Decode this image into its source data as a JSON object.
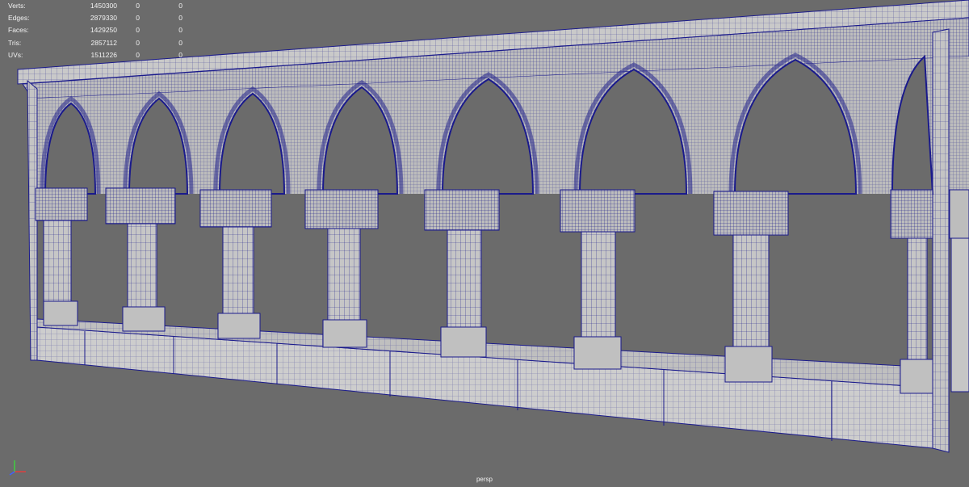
{
  "hud": {
    "rows": [
      {
        "label": "Verts:",
        "total": "1450300",
        "selected": "0",
        "selected2": "0"
      },
      {
        "label": "Edges:",
        "total": "2879330",
        "selected": "0",
        "selected2": "0"
      },
      {
        "label": "Faces:",
        "total": "1429250",
        "selected": "0",
        "selected2": "0"
      },
      {
        "label": "Tris:",
        "total": "2857112",
        "selected": "0",
        "selected2": "0"
      },
      {
        "label": "UVs:",
        "total": "1511226",
        "selected": "0",
        "selected2": "0"
      }
    ]
  },
  "viewport": {
    "camera": "persp",
    "background_color": "#6b6b6b",
    "mesh_color": "#c8c8c8",
    "wire_color": "#1a1a8c"
  },
  "axis_icon": {
    "icon": "axis-gizmo-icon"
  }
}
